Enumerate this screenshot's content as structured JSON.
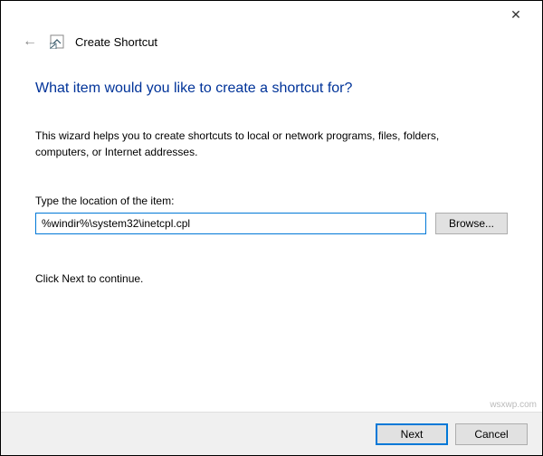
{
  "titlebar": {
    "close_symbol": "✕"
  },
  "header": {
    "back_symbol": "←",
    "title": "Create Shortcut"
  },
  "content": {
    "heading": "What item would you like to create a shortcut for?",
    "description": "This wizard helps you to create shortcuts to local or network programs, files, folders, computers, or Internet addresses.",
    "field_label": "Type the location of the item:",
    "location_value": "%windir%\\system32\\inetcpl.cpl",
    "browse_label": "Browse...",
    "continue_text": "Click Next to continue."
  },
  "footer": {
    "next_label": "Next",
    "cancel_label": "Cancel"
  },
  "watermark": "wsxwp.com"
}
